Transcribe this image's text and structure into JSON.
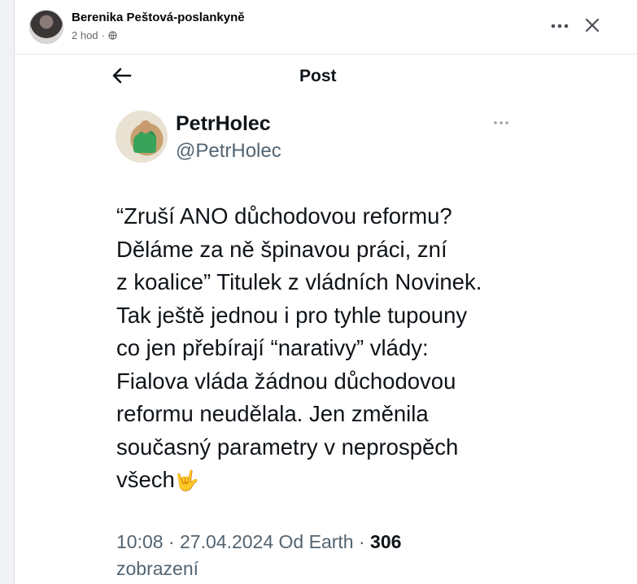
{
  "fb_post": {
    "author": "Berenika Peštová-poslankyně",
    "time": "2 hod",
    "separator": "·"
  },
  "tweet": {
    "header_title": "Post",
    "name": "PetrHolec",
    "handle": "@PetrHolec",
    "text": "“Zruší ANO důchodovou reformu?\nDěláme za ně špinavou práci, zní\nz koalice” Titulek z vládních Novinek.\nTak ještě jednou i pro tyhle tupouny\nco jen přebírají “narativy” vlády:\nFialova vláda žádnou důchodovou\nreformu neudělala. Jen změnila\nsoučasný parametry v neprospěch\nvšech",
    "emoji": "🤟",
    "time": "10:08",
    "date": "27.04.2024",
    "source": "Od Earth",
    "views_count": "306",
    "views_label": "zobrazení"
  },
  "icons": {
    "fb_more": "more-horizontal-icon",
    "fb_close": "close-icon",
    "globe": "globe-icon",
    "back": "arrow-left-icon",
    "tweet_more": "more-horizontal-icon"
  },
  "colors": {
    "page_bg": "#f0f2f5",
    "text_primary": "#0f1419",
    "text_secondary": "#536471",
    "fb_meta": "#65676b"
  }
}
